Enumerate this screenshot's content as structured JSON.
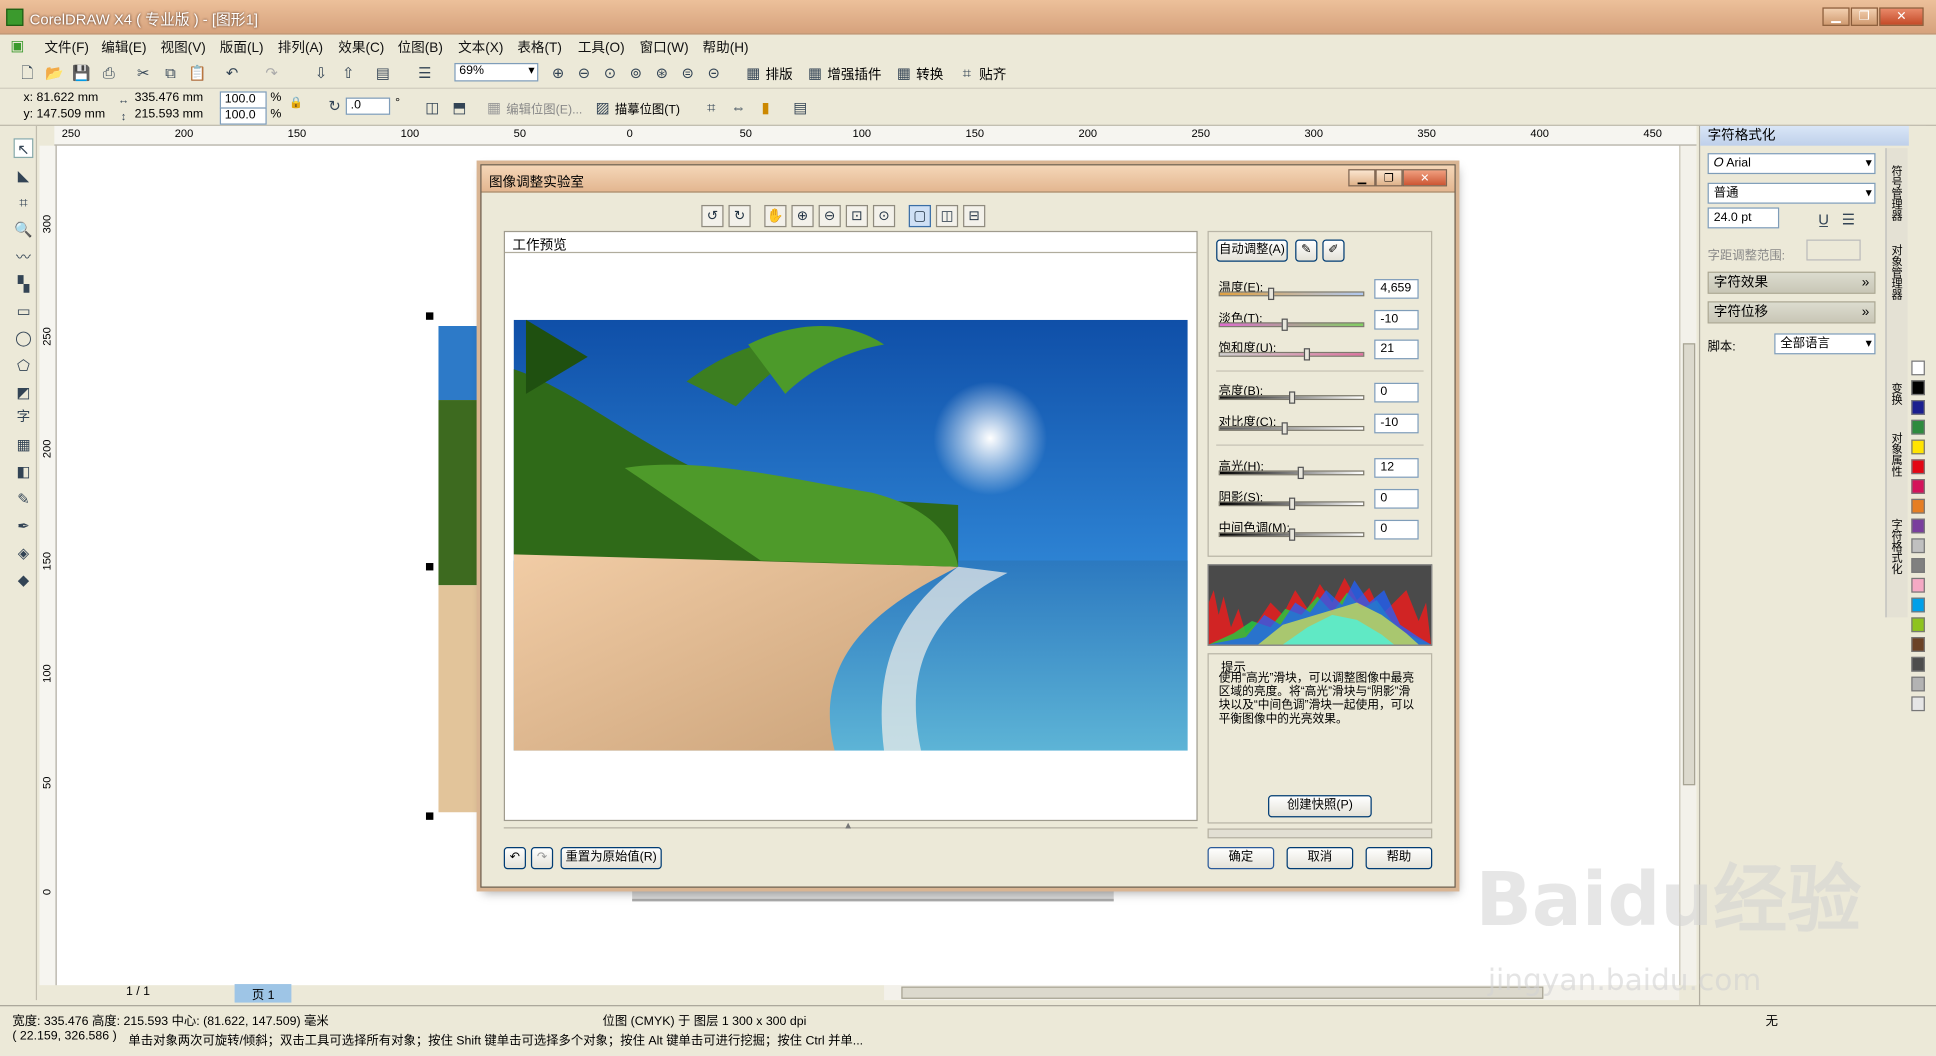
{
  "app": {
    "title": "CorelDRAW X4 ( 专业版 ) - [图形1]",
    "menus": [
      "文件(F)",
      "编辑(E)",
      "视图(V)",
      "版面(L)",
      "排列(A)",
      "效果(C)",
      "位图(B)",
      "文本(X)",
      "表格(T)",
      "工具(O)",
      "窗口(W)",
      "帮助(H)"
    ]
  },
  "toolbar": {
    "zoom": "69%",
    "labels": [
      "排版",
      "增强插件",
      "转换",
      "贴齐"
    ]
  },
  "propbar": {
    "x": "x: 81.622 mm",
    "y": "y: 147.509 mm",
    "w": "335.476 mm",
    "h": "215.593 mm",
    "sx": "100.0",
    "sy": "100.0",
    "pct": "%",
    "rot": ".0",
    "deg": "°",
    "edit_bitmap": "编辑位图(E)...",
    "trace_bitmap": "描摹位图(T)"
  },
  "ruler_h": [
    "250",
    "200",
    "150",
    "100",
    "50",
    "0",
    "50",
    "100",
    "150",
    "200",
    "250",
    "300",
    "350",
    "400",
    "450"
  ],
  "ruler_v": [
    "300",
    "250",
    "200",
    "150",
    "100",
    "50",
    "0"
  ],
  "page_nav": {
    "count": "1 / 1",
    "tab": "页 1"
  },
  "dialog": {
    "title": "图像调整实验室",
    "preview_label": "工作预览",
    "auto_adjust": "自动调整(A)",
    "sliders": [
      {
        "label": "温度(E):",
        "value": "4,659",
        "level": 0.36
      },
      {
        "label": "淡色(T):",
        "value": "-10",
        "level": 0.45
      },
      {
        "label": "饱和度(U):",
        "value": "21",
        "level": 0.6
      },
      {
        "label": "亮度(B):",
        "value": "0",
        "level": 0.5
      },
      {
        "label": "对比度(C):",
        "value": "-10",
        "level": 0.45
      },
      {
        "label": "高光(H):",
        "value": "12",
        "level": 0.56
      },
      {
        "label": "阴影(S):",
        "value": "0",
        "level": 0.5
      },
      {
        "label": "中间色调(M):",
        "value": "0",
        "level": 0.5
      }
    ],
    "hint_title": "提示",
    "hint_text": "使用“高光”滑块，可以调整图像中最亮区域的亮度。将“高光”滑块与“阴影”滑块以及“中间色调”滑块一起使用，可以平衡图像中的光亮效果。",
    "snapshot": "创建快照(P)",
    "reset": "重置为原始值(R)",
    "ok": "确定",
    "cancel": "取消",
    "help": "帮助"
  },
  "docker": {
    "title": "字符格式化",
    "font": "Arial",
    "style": "普通",
    "size": "24.0 pt",
    "range_label": "字距调整范围:",
    "effects": "字符效果",
    "position": "字符位移",
    "script_label": "脚本:",
    "script_value": "全部语言",
    "side_tabs": [
      "符号管理器",
      "对象管理器",
      "变换",
      "对象属性",
      "字符格式化"
    ]
  },
  "palette_colors": [
    "#ffffff",
    "#000000",
    "#1b1f8f",
    "#2e8b3e",
    "#ffe400",
    "#e30613",
    "#d4145a",
    "#e67e22",
    "#7a3e9d",
    "#c0c0c0",
    "#808080",
    "#f5a9c4",
    "#00a0e9",
    "#8ec31f",
    "#6b4226",
    "#4d4d4d",
    "#b3b3b3",
    "#e6e6e6"
  ],
  "status": {
    "dims": "宽度: 335.476 高度: 215.593 中心: (81.622, 147.509) 毫米",
    "layer": "位图 (CMYK) 于 图层 1 300 x 300 dpi",
    "coords": "( 22.159, 326.586 )",
    "hint": "单击对象两次可旋转/倾斜；双击工具可选择所有对象；按住 Shift 键单击可选择多个对象；按住 Alt 键单击可进行挖掘；按住 Ctrl 并单...",
    "fill_none": "无"
  },
  "watermark": {
    "logo": "Baidu经验",
    "url": "jingyan.baidu.com"
  }
}
